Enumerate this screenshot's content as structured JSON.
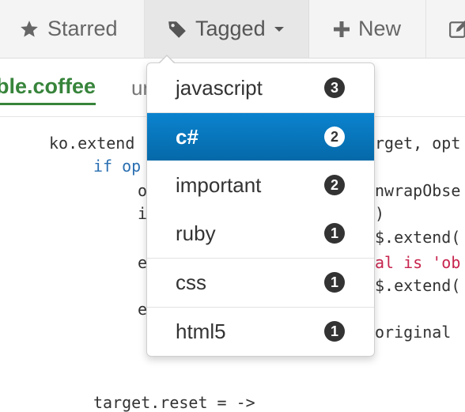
{
  "nav": {
    "starred": "Starred",
    "tagged": "Tagged",
    "new": "New"
  },
  "file": {
    "name": "able.coffee",
    "meta": "ur"
  },
  "code_lines": [
    "ko.extend",
    "if op",
    "o",
    "i",
    "e",
    "e",
    "target.reset = ->"
  ],
  "code_right": [
    "rget, opt",
    "nwrapObse",
    ")",
    "$.extend(",
    "al is 'ob",
    "$.extend(",
    "original"
  ],
  "tags_menu": {
    "items": [
      {
        "label": "javascript",
        "count": "3"
      },
      {
        "label": "c#",
        "count": "2"
      },
      {
        "label": "important",
        "count": "2"
      },
      {
        "label": "ruby",
        "count": "1"
      },
      {
        "label": "css",
        "count": "1"
      },
      {
        "label": "html5",
        "count": "1"
      }
    ],
    "active_index": 1
  }
}
